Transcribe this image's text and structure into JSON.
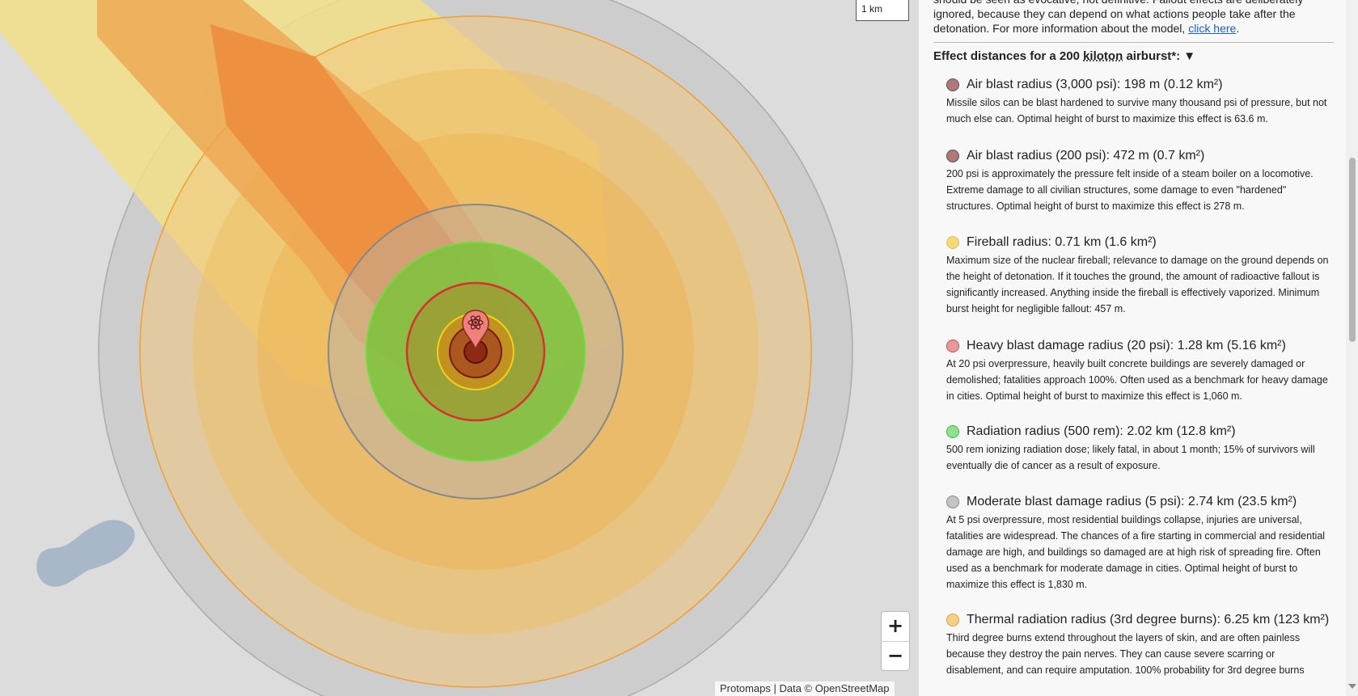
{
  "map": {
    "scale_label": "1 km",
    "zoom_in": "+",
    "zoom_out": "−",
    "attribution": "Protomaps | Data © OpenStreetMap",
    "marker_icon": "atom-marker-icon"
  },
  "panel": {
    "intro_line1": "should be seen as evocative, not definitive. Fallout effects are deliberately",
    "intro_line2": "ignored, because they can depend on what actions people take after the",
    "intro_line3": "detonation. For more information about the model,",
    "intro_link": "click here",
    "intro_end": ".",
    "heading_prefix": "Effect distances for a 200",
    "heading_unit": "kiloton",
    "heading_suffix": "airburst*:",
    "heading_toggle": "▼",
    "effects": [
      {
        "title": "Air blast radius (3,000 psi): 198 m (0.12 km²)",
        "color": "#b07878",
        "desc": "Missile silos can be blast hardened to survive many thousand psi of pressure, but not much else can. Optimal height of burst to maximize this effect is 63.6 m."
      },
      {
        "title": "Air blast radius (200 psi): 472 m (0.7 km²)",
        "color": "#b07878",
        "desc": "200 psi is approximately the pressure felt inside of a steam boiler on a locomotive. Extreme damage to all civilian structures, some damage to even \"hardened\" structures. Optimal height of burst to maximize this effect is 278 m."
      },
      {
        "title": "Fireball radius: 0.71 km (1.6 km²)",
        "color": "#f5d77a",
        "desc": "Maximum size of the nuclear fireball; relevance to damage on the ground depends on the height of detonation. If it touches the ground, the amount of radioactive fallout is significantly increased. Anything inside the fireball is effectively vaporized. Minimum burst height for negligible fallout: 457 m."
      },
      {
        "title": "Heavy blast damage radius (20 psi): 1.28 km (5.16 km²)",
        "color": "#e89a9a",
        "desc": "At 20 psi overpressure, heavily built concrete buildings are severely damaged or demolished; fatalities approach 100%. Often used as a benchmark for heavy damage in cities. Optimal height of burst to maximize this effect is 1,060 m."
      },
      {
        "title": "Radiation radius (500 rem): 2.02 km (12.8 km²)",
        "color": "#8fe08f",
        "desc": "500 rem ionizing radiation dose; likely fatal, in about 1 month; 15% of survivors will eventually die of cancer as a result of exposure."
      },
      {
        "title": "Moderate blast damage radius (5 psi): 2.74 km (23.5 km²)",
        "color": "#c4c4c4",
        "desc": "At 5 psi overpressure, most residential buildings collapse, injuries are universal, fatalities are widespread. The chances of a fire starting in commercial and residential damage are high, and buildings so damaged are at high risk of spreading fire. Often used as a benchmark for moderate damage in cities. Optimal height of burst to maximize this effect is 1,830 m."
      },
      {
        "title": "Thermal radiation radius (3rd degree burns): 6.25 km (123 km²)",
        "color": "#f3cf8a",
        "desc": "Third degree burns extend throughout the layers of skin, and are often painless because they destroy the pain nerves. They can cause severe scarring or disablement, and can require amputation. 100% probability for 3rd degree burns"
      }
    ]
  }
}
